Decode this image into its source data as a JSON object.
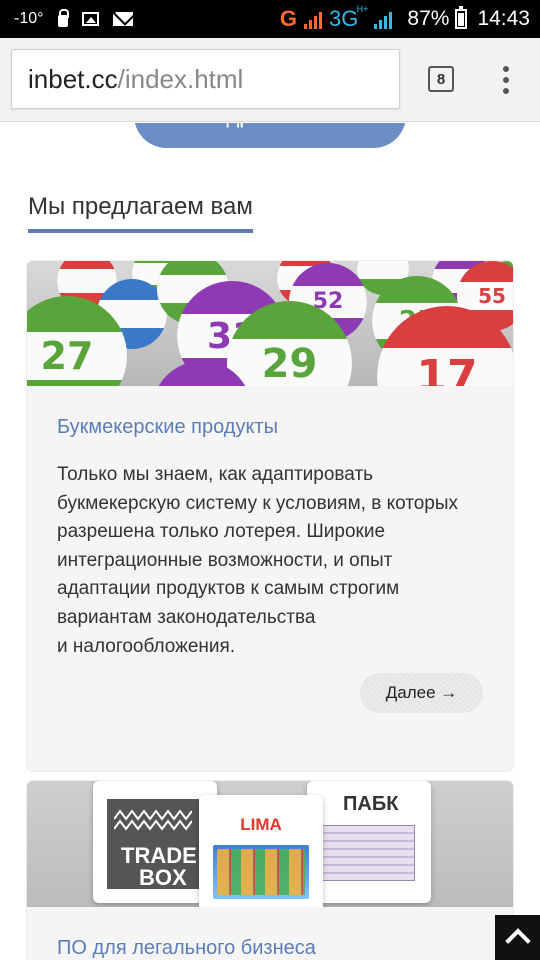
{
  "status_bar": {
    "temperature": "-10°",
    "network_g": "G",
    "network_3g": "3G",
    "network_3g_sup": "H+",
    "battery": "87%",
    "time": "14:43"
  },
  "browser": {
    "url_host": "inbet.cc",
    "url_path": "/index.html",
    "tab_count": "8"
  },
  "page": {
    "more_button_label": "Подробнее →",
    "section_title": "Мы предлагаем вам",
    "cards": [
      {
        "title": "Букмекерские продукты",
        "text_lines": [
          "Только мы знаем, как адаптировать",
          "букмекерскую систему к условиям, в которых",
          "разрешена только лотерея. Широкие",
          "интеграционные возможности, и опыт",
          "адаптации продуктов к самым строгим",
          "вариантам законодательства",
          "и налогообложения."
        ],
        "link_label": "Далее →",
        "image": {
          "balls": [
            "27",
            "31",
            "29",
            "17",
            "52",
            "25",
            "55"
          ]
        }
      },
      {
        "title": "ПО для легального бизнеса",
        "image": {
          "logo_left_line1": "TRADE",
          "logo_left_line2": "BOX",
          "logo_center": "LIMA",
          "logo_right": "ПАБК"
        }
      }
    ]
  },
  "colors": {
    "accent": "#5b7db8",
    "button": "#6d8ec4",
    "status_bar": "#000000",
    "network_g": "#ff6a2a",
    "network_3g": "#35b9e8"
  }
}
